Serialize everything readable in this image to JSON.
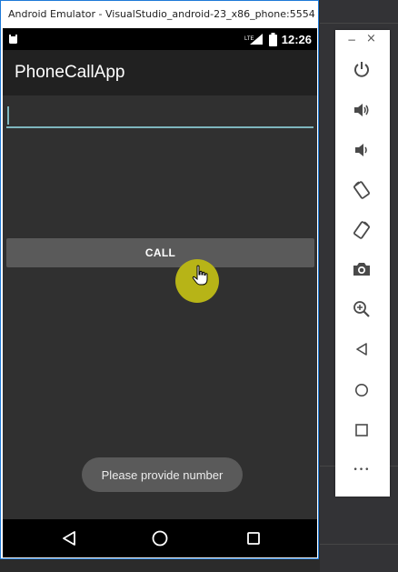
{
  "window": {
    "title": "Android Emulator - VisualStudio_android-23_x86_phone:5554"
  },
  "statusbar": {
    "network_label": "LTE",
    "time": "12:26",
    "icons": [
      "android-icon",
      "lte-signal-icon",
      "battery-icon"
    ]
  },
  "app": {
    "title": "PhoneCallApp",
    "phone_input": {
      "value": "",
      "placeholder": ""
    },
    "call_button_label": "CALL",
    "toast": "Please provide number"
  },
  "navbar": {
    "icons": [
      "back-icon",
      "home-icon",
      "recents-icon"
    ]
  },
  "side_toolbar": {
    "minimize_label": "−",
    "close_label": "×",
    "buttons": [
      "power-icon",
      "volume-up-icon",
      "volume-down-icon",
      "rotate-left-icon",
      "rotate-right-icon",
      "camera-icon",
      "zoom-icon",
      "back-icon",
      "home-icon",
      "overview-icon",
      "more-icon"
    ],
    "more_label": "•••"
  },
  "colors": {
    "accent": "#7eb6bd",
    "touch_indicator": "#b7b417",
    "window_border": "#1e7ad8"
  }
}
